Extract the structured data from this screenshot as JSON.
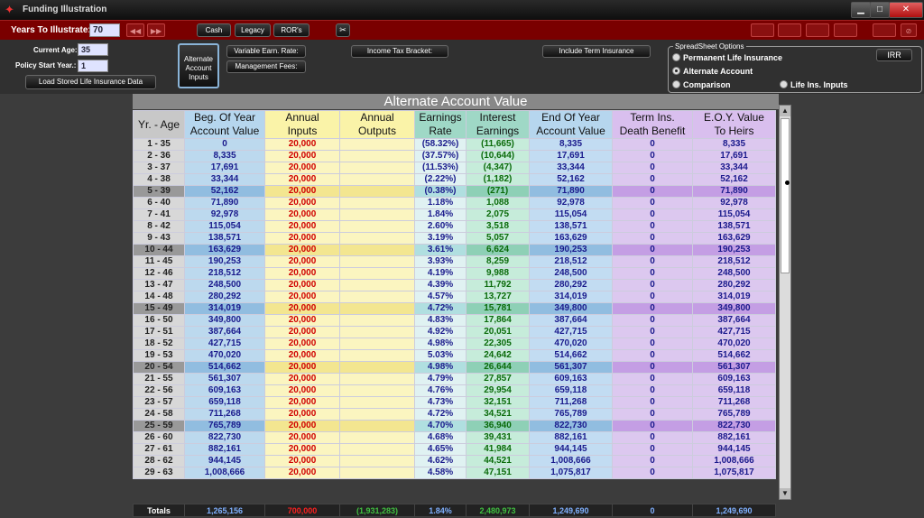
{
  "window": {
    "title": "Funding Illustration",
    "minimize": "▁",
    "restore": "□",
    "close": "✕"
  },
  "toolbar": {
    "years_label": "Years To Illustrate:",
    "years_value": "70",
    "cash_label": "Cash",
    "legacy_label": "Legacy",
    "rors_label": "ROR's",
    "irr_label": "IRR"
  },
  "inputs": {
    "current_age_label": "Current Age:",
    "current_age_value": "35",
    "policy_start_label": "Policy Start Year.:",
    "policy_start_value": "1",
    "load_button": "Load Stored Life Insurance Data",
    "alt_account_button": "Alternate Account Inputs",
    "variable_rate_button": "Variable Earn. Rate:",
    "management_fees_button": "Management Fees:",
    "income_tax_button": "Income Tax Bracket:",
    "term_insurance_button": "Include Term Insurance"
  },
  "spreadsheet_options": {
    "title": "SpreadSheet Options",
    "options": [
      "Permanent Life Insurance",
      "Alternate Account",
      "Comparison",
      "Life Ins. Inputs"
    ],
    "selected": "Alternate Account"
  },
  "sheet": {
    "title": "Alternate Account Value",
    "headers": [
      [
        "Yr. - Age",
        ""
      ],
      [
        "Beg. Of Year",
        "Account Value"
      ],
      [
        "Annual",
        "Inputs"
      ],
      [
        "Annual",
        "Outputs"
      ],
      [
        "Earnings",
        "Rate"
      ],
      [
        "Interest",
        "Earnings"
      ],
      [
        "End Of Year",
        "Account Value"
      ],
      [
        "Term Ins.",
        "Death Benefit"
      ],
      [
        "E.O.Y. Value",
        "To Heirs"
      ]
    ],
    "rows": [
      [
        "1 - 35",
        "0",
        "20,000",
        "",
        "(58.32%)",
        "(11,665)",
        "8,335",
        "0",
        "8,335"
      ],
      [
        "2 - 36",
        "8,335",
        "20,000",
        "",
        "(37.57%)",
        "(10,644)",
        "17,691",
        "0",
        "17,691"
      ],
      [
        "3 - 37",
        "17,691",
        "20,000",
        "",
        "(11.53%)",
        "(4,347)",
        "33,344",
        "0",
        "33,344"
      ],
      [
        "4 - 38",
        "33,344",
        "20,000",
        "",
        "(2.22%)",
        "(1,182)",
        "52,162",
        "0",
        "52,162"
      ],
      [
        "5 - 39",
        "52,162",
        "20,000",
        "",
        "(0.38%)",
        "(271)",
        "71,890",
        "0",
        "71,890"
      ],
      [
        "6 - 40",
        "71,890",
        "20,000",
        "",
        "1.18%",
        "1,088",
        "92,978",
        "0",
        "92,978"
      ],
      [
        "7 - 41",
        "92,978",
        "20,000",
        "",
        "1.84%",
        "2,075",
        "115,054",
        "0",
        "115,054"
      ],
      [
        "8 - 42",
        "115,054",
        "20,000",
        "",
        "2.60%",
        "3,518",
        "138,571",
        "0",
        "138,571"
      ],
      [
        "9 - 43",
        "138,571",
        "20,000",
        "",
        "3.19%",
        "5,057",
        "163,629",
        "0",
        "163,629"
      ],
      [
        "10 - 44",
        "163,629",
        "20,000",
        "",
        "3.61%",
        "6,624",
        "190,253",
        "0",
        "190,253"
      ],
      [
        "11 - 45",
        "190,253",
        "20,000",
        "",
        "3.93%",
        "8,259",
        "218,512",
        "0",
        "218,512"
      ],
      [
        "12 - 46",
        "218,512",
        "20,000",
        "",
        "4.19%",
        "9,988",
        "248,500",
        "0",
        "248,500"
      ],
      [
        "13 - 47",
        "248,500",
        "20,000",
        "",
        "4.39%",
        "11,792",
        "280,292",
        "0",
        "280,292"
      ],
      [
        "14 - 48",
        "280,292",
        "20,000",
        "",
        "4.57%",
        "13,727",
        "314,019",
        "0",
        "314,019"
      ],
      [
        "15 - 49",
        "314,019",
        "20,000",
        "",
        "4.72%",
        "15,781",
        "349,800",
        "0",
        "349,800"
      ],
      [
        "16 - 50",
        "349,800",
        "20,000",
        "",
        "4.83%",
        "17,864",
        "387,664",
        "0",
        "387,664"
      ],
      [
        "17 - 51",
        "387,664",
        "20,000",
        "",
        "4.92%",
        "20,051",
        "427,715",
        "0",
        "427,715"
      ],
      [
        "18 - 52",
        "427,715",
        "20,000",
        "",
        "4.98%",
        "22,305",
        "470,020",
        "0",
        "470,020"
      ],
      [
        "19 - 53",
        "470,020",
        "20,000",
        "",
        "5.03%",
        "24,642",
        "514,662",
        "0",
        "514,662"
      ],
      [
        "20 - 54",
        "514,662",
        "20,000",
        "",
        "4.98%",
        "26,644",
        "561,307",
        "0",
        "561,307"
      ],
      [
        "21 - 55",
        "561,307",
        "20,000",
        "",
        "4.79%",
        "27,857",
        "609,163",
        "0",
        "609,163"
      ],
      [
        "22 - 56",
        "609,163",
        "20,000",
        "",
        "4.76%",
        "29,954",
        "659,118",
        "0",
        "659,118"
      ],
      [
        "23 - 57",
        "659,118",
        "20,000",
        "",
        "4.73%",
        "32,151",
        "711,268",
        "0",
        "711,268"
      ],
      [
        "24 - 58",
        "711,268",
        "20,000",
        "",
        "4.72%",
        "34,521",
        "765,789",
        "0",
        "765,789"
      ],
      [
        "25 - 59",
        "765,789",
        "20,000",
        "",
        "4.70%",
        "36,940",
        "822,730",
        "0",
        "822,730"
      ],
      [
        "26 - 60",
        "822,730",
        "20,000",
        "",
        "4.68%",
        "39,431",
        "882,161",
        "0",
        "882,161"
      ],
      [
        "27 - 61",
        "882,161",
        "20,000",
        "",
        "4.65%",
        "41,984",
        "944,145",
        "0",
        "944,145"
      ],
      [
        "28 - 62",
        "944,145",
        "20,000",
        "",
        "4.62%",
        "44,521",
        "1,008,666",
        "0",
        "1,008,666"
      ],
      [
        "29 - 63",
        "1,008,666",
        "20,000",
        "",
        "4.58%",
        "47,151",
        "1,075,817",
        "0",
        "1,075,817"
      ]
    ],
    "totals": [
      "Totals",
      "1,265,156",
      "700,000",
      "(1,931,283)",
      "1.84%",
      "2,480,973",
      "1,249,690",
      "0",
      "1,249,690"
    ],
    "totals_colors": [
      "#ffffff",
      "#7fb0ff",
      "#ff2020",
      "#40c040",
      "#7fb0ff",
      "#40c040",
      "#7fb0ff",
      "#7fb0ff",
      "#7fb0ff"
    ]
  }
}
